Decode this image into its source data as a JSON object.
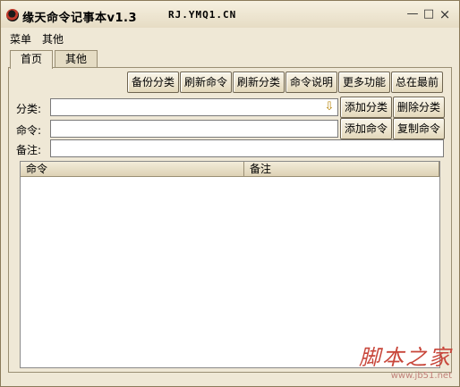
{
  "window": {
    "title": "缘天命令记事本v1.3",
    "site": "RJ.YMQ1.CN",
    "minimize": "—",
    "maximize": "□",
    "close": "×"
  },
  "menu": {
    "items": [
      {
        "label": "菜单"
      },
      {
        "label": "其他"
      }
    ]
  },
  "tabs": [
    {
      "label": "首页"
    },
    {
      "label": "其他"
    }
  ],
  "toolbar": {
    "backup_category": "备份分类",
    "refresh_command": "刷新命令",
    "refresh_category": "刷新分类",
    "command_help": "命令说明",
    "more_features": "更多功能",
    "always_on_top": "总在最前"
  },
  "form": {
    "category_label": "分类:",
    "command_label": "命令:",
    "note_label": "备注:",
    "category_value": "",
    "command_value": "",
    "note_value": "",
    "add_category": "添加分类",
    "delete_category": "删除分类",
    "add_command": "添加命令",
    "copy_command": "复制命令"
  },
  "list": {
    "columns": [
      {
        "label": "命令"
      },
      {
        "label": "备注"
      }
    ],
    "rows": []
  },
  "watermark": {
    "text": "脚本之家",
    "url": "www.jb51.net"
  },
  "colors": {
    "background": "#efe8d6",
    "watermark": "#c8463a"
  }
}
